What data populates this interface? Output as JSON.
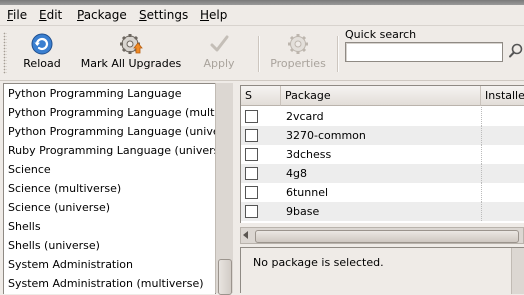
{
  "menu": [
    {
      "label": "File",
      "mnemonic": "F",
      "rest": "ile"
    },
    {
      "label": "Edit",
      "mnemonic": "E",
      "rest": "dit"
    },
    {
      "label": "Package",
      "mnemonic": "P",
      "rest": "ackage"
    },
    {
      "label": "Settings",
      "mnemonic": "S",
      "rest": "ettings"
    },
    {
      "label": "Help",
      "mnemonic": "H",
      "rest": "elp"
    }
  ],
  "toolbar": {
    "reload": {
      "label": "Reload",
      "icon": "reload-icon",
      "enabled": true
    },
    "mark_all": {
      "label": "Mark All Upgrades",
      "icon": "upgrade-gear-icon",
      "enabled": true
    },
    "apply": {
      "label": "Apply",
      "icon": "checkmark-icon",
      "enabled": false
    },
    "properties": {
      "label": "Properties",
      "icon": "gear-icon",
      "enabled": false
    }
  },
  "quick_search": {
    "label": "Quick search",
    "value": "",
    "placeholder": ""
  },
  "categories": [
    "Python Programming Language",
    "Python Programming Language (multi",
    "Python Programming Language (unive",
    "Ruby Programming Language (univers",
    "Science",
    "Science (multiverse)",
    "Science (universe)",
    "Shells",
    "Shells (universe)",
    "System Administration",
    "System Administration (multiverse)"
  ],
  "table": {
    "columns": [
      "S",
      "Package",
      "Installe"
    ],
    "rows": [
      {
        "checked": false,
        "package": "2vcard"
      },
      {
        "checked": false,
        "package": "3270-common"
      },
      {
        "checked": false,
        "package": "3dchess"
      },
      {
        "checked": false,
        "package": "4g8"
      },
      {
        "checked": false,
        "package": "6tunnel"
      },
      {
        "checked": false,
        "package": "9base"
      }
    ]
  },
  "description": {
    "text": "No package is selected."
  },
  "colors": {
    "window_bg": "#efebe7",
    "reload_blue": "#3a7fd0",
    "upgrade_orange": "#f08a24",
    "disabled_gray": "#a9a39c",
    "row_alt": "#ededed"
  }
}
